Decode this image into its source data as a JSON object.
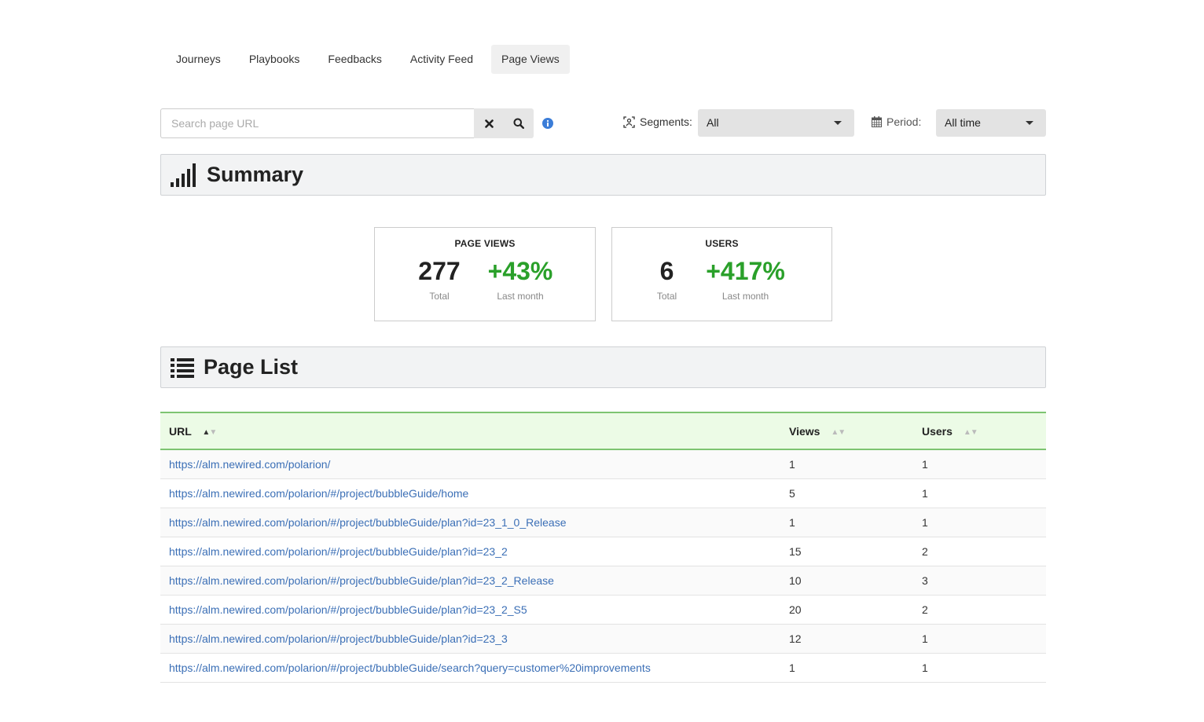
{
  "tabs": [
    {
      "label": "Journeys"
    },
    {
      "label": "Playbooks"
    },
    {
      "label": "Feedbacks"
    },
    {
      "label": "Activity Feed"
    },
    {
      "label": "Page Views",
      "active": true
    }
  ],
  "search": {
    "placeholder": "Search page URL",
    "value": ""
  },
  "filters": {
    "segments_label": "Segments:",
    "segments_value": "All",
    "period_label": "Period:",
    "period_value": "All time"
  },
  "summary": {
    "title": "Summary",
    "page_views": {
      "title": "PAGE VIEWS",
      "total": "277",
      "total_label": "Total",
      "change": "+43%",
      "change_label": "Last month"
    },
    "users": {
      "title": "USERS",
      "total": "6",
      "total_label": "Total",
      "change": "+417%",
      "change_label": "Last month"
    }
  },
  "page_list": {
    "title": "Page List",
    "columns": {
      "url": "URL",
      "views": "Views",
      "users": "Users"
    },
    "rows": [
      {
        "url": "https://alm.newired.com/polarion/",
        "views": "1",
        "users": "1"
      },
      {
        "url": "https://alm.newired.com/polarion/#/project/bubbleGuide/home",
        "views": "5",
        "users": "1"
      },
      {
        "url": "https://alm.newired.com/polarion/#/project/bubbleGuide/plan?id=23_1_0_Release",
        "views": "1",
        "users": "1"
      },
      {
        "url": "https://alm.newired.com/polarion/#/project/bubbleGuide/plan?id=23_2",
        "views": "15",
        "users": "2"
      },
      {
        "url": "https://alm.newired.com/polarion/#/project/bubbleGuide/plan?id=23_2_Release",
        "views": "10",
        "users": "3"
      },
      {
        "url": "https://alm.newired.com/polarion/#/project/bubbleGuide/plan?id=23_2_S5",
        "views": "20",
        "users": "2"
      },
      {
        "url": "https://alm.newired.com/polarion/#/project/bubbleGuide/plan?id=23_3",
        "views": "12",
        "users": "1"
      },
      {
        "url": "https://alm.newired.com/polarion/#/project/bubbleGuide/search?query=customer%20improvements",
        "views": "1",
        "users": "1"
      }
    ]
  },
  "colors": {
    "accent_green": "#2aa02a",
    "link": "#3b6fb6",
    "info": "#3b7dd8",
    "table_header_bg": "#ecfbe6",
    "table_header_border": "#7dc471"
  }
}
